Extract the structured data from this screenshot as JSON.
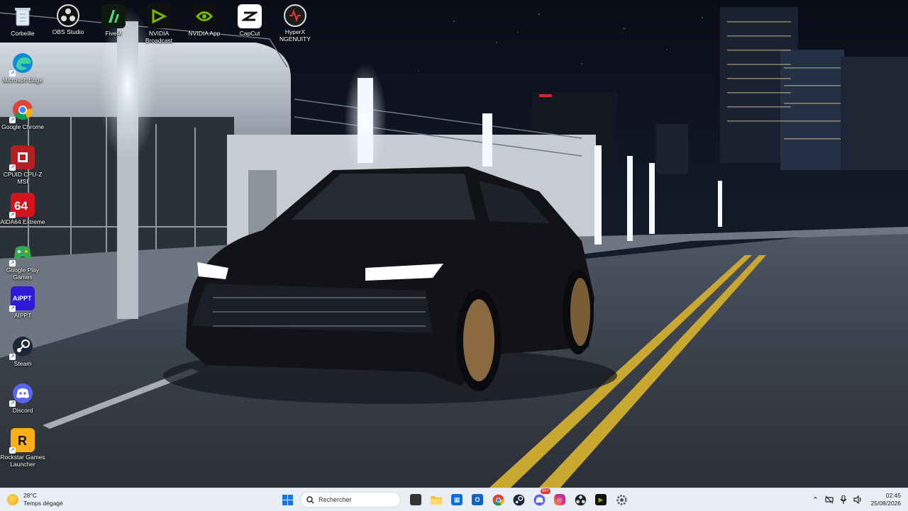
{
  "desktop": {
    "icons_top": [
      {
        "label": "Corbeille",
        "icon": "recycle-bin-icon"
      },
      {
        "label": "OBS Studio",
        "icon": "obs-icon"
      },
      {
        "label": "FiveM",
        "icon": "fivem-icon"
      },
      {
        "label": "NVIDIA Broadcast",
        "icon": "nvidia-broadcast-icon"
      },
      {
        "label": "NVIDIA App",
        "icon": "nvidia-icon"
      },
      {
        "label": "CapCut",
        "icon": "capcut-icon"
      },
      {
        "label": "HyperX NGENUITY",
        "icon": "hyperx-icon"
      }
    ],
    "icons_left": [
      {
        "label": "Microsoft Edge",
        "icon": "edge-icon"
      },
      {
        "label": "Google Chrome",
        "icon": "chrome-icon"
      },
      {
        "label": "CPUID CPU-Z MSI",
        "icon": "cpuz-icon"
      },
      {
        "label": "AIDA64 Extreme",
        "icon": "aida64-icon"
      },
      {
        "label": "Google Play Games",
        "icon": "google-play-games-icon"
      },
      {
        "label": "AIPPT",
        "icon": "aippt-icon"
      },
      {
        "label": "Steam",
        "icon": "steam-icon"
      },
      {
        "label": "Discord",
        "icon": "discord-icon"
      },
      {
        "label": "Rockstar Games Launcher",
        "icon": "rockstar-icon"
      }
    ]
  },
  "taskbar": {
    "weather": {
      "temp": "28°C",
      "desc": "Temps dégagé"
    },
    "search": {
      "placeholder": "Rechercher"
    },
    "pinned": [
      "task-view-icon",
      "file-explorer-icon",
      "microsoft-store-icon",
      "outlook-icon",
      "chrome-icon",
      "steam-icon",
      "discord-icon",
      "instagram-icon",
      "obs-icon",
      "nvidia-icon",
      "settings-icon"
    ],
    "discord_badge": "99+",
    "clock": {
      "time": "02:45",
      "date": "25/08/2026"
    }
  },
  "colors": {
    "taskbar_bg": "#e9eef4",
    "accent": "#1a78d4"
  }
}
